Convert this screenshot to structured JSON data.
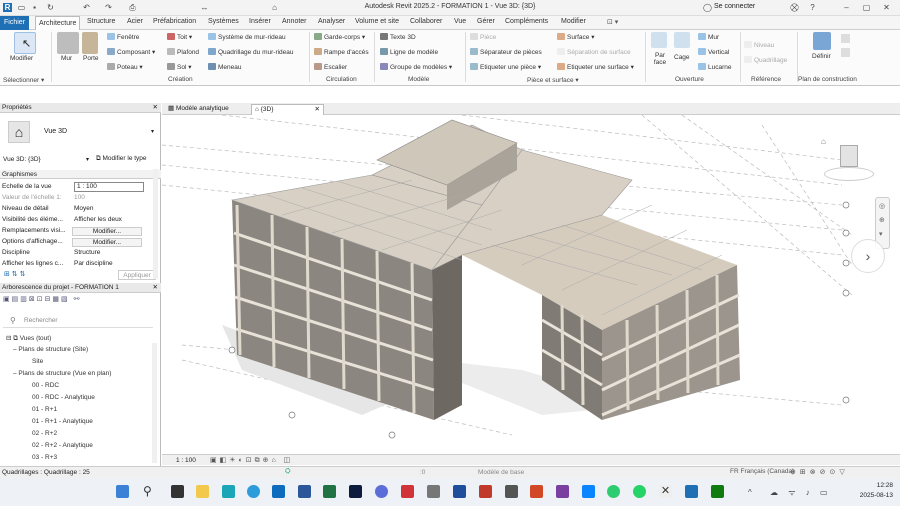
{
  "window": {
    "title": "Autodesk Revit 2025.2 - FORMATION 1 - Vue 3D: {3D}",
    "user": "Se connecter"
  },
  "tabs": [
    "Fichier",
    "Architecture",
    "Structure",
    "Acier",
    "Préfabrication",
    "Systèmes",
    "Insérer",
    "Annoter",
    "Analyser",
    "Volume et site",
    "Collaborer",
    "Vue",
    "Gérer",
    "Compléments",
    "Modifier"
  ],
  "ribbon": {
    "modify": "Modifier",
    "select": "Sélectionner ▾",
    "build": {
      "mur": "Mur",
      "porte": "Porte",
      "fenetre": "Fenêtre",
      "composant": "Composant",
      "poteau": "Poteau",
      "toit": "Toit",
      "plafond": "Plafond",
      "sol": "Sol",
      "systeme_mur_rideau": "Système de mur-rideau",
      "quadrillage_mur_rideau": "Quadrillage du mur-rideau",
      "meneau": "Meneau",
      "label": "Création"
    },
    "circulation": {
      "garde_corps": "Garde-corps",
      "rampe": "Rampe d'accès",
      "escalier": "Escalier",
      "label": "Circulation"
    },
    "model": {
      "texte3d": "Texte 3D",
      "ligne": "Ligne de modèle",
      "groupe": "Groupe de modèles",
      "label": "Modèle"
    },
    "room": {
      "piece": "Pièce",
      "separateur": "Séparateur de pièces",
      "etiquette_piece": "Etiqueter une pièce",
      "surface": "Surface",
      "separation_surface": "Séparation de surface",
      "etiquette_surface": "Etiqueter une surface",
      "label": "Pièce et surface ▾"
    },
    "opening": {
      "par_face": "Par face",
      "cage": "Cage",
      "mur": "Mur",
      "vertical": "Vertical",
      "lucarne": "Lucarne",
      "label": "Ouverture"
    },
    "datum": {
      "niveau": "Niveau",
      "quadrillage": "Quadrillage",
      "label": "Référence"
    },
    "workplane": {
      "definir": "Définir",
      "label": "Plan de construction"
    }
  },
  "properties": {
    "header": "Propriétés",
    "type": "Vue 3D",
    "selector": "Vue 3D: {3D}",
    "edit_type": "Modifier le type",
    "section": "Graphismes",
    "rows": [
      {
        "k": "Echelle de la vue",
        "v": "1 : 100"
      },
      {
        "k": "Valeur de l'échelle 1:",
        "v": "100"
      },
      {
        "k": "Niveau de détail",
        "v": "Moyen"
      },
      {
        "k": "Visibilité des éléme...",
        "v": "Afficher les deux"
      },
      {
        "k": "Remplacements visi...",
        "v": "Modifier..."
      },
      {
        "k": "Options d'affichage...",
        "v": "Modifier..."
      },
      {
        "k": "Discipline",
        "v": "Structure"
      },
      {
        "k": "Afficher les lignes c...",
        "v": "Par discipline"
      }
    ],
    "apply": "Appliquer"
  },
  "browser": {
    "header": "Arborescence du projet - FORMATION 1",
    "search": "Rechercher",
    "items": [
      "Vues (tout)",
      "Plans de structure (Site)",
      "Site",
      "Plans de structure (Vue en plan)",
      "00 - RDC",
      "00 - RDC - Analytique",
      "01 - R+1",
      "01 - R+1 - Analytique",
      "02 - R+2",
      "02 - R+2 - Analytique",
      "03 - R+3"
    ]
  },
  "viewtabs": [
    "Modèle analytique",
    "{3D}"
  ],
  "viewbar": {
    "scale": "1 : 100"
  },
  "status": {
    "left": "Quadrillages : Quadrillage : 25",
    "mid": ":0",
    "model": "Modèle de base"
  },
  "taskbar": {
    "lang": "FR Français (Canada)",
    "time": "12:28",
    "date": "2025-08-13"
  },
  "colors": {
    "accent": "#1f6fb5",
    "slab": "#d8d0c4",
    "structure": "#c9c3ba"
  }
}
